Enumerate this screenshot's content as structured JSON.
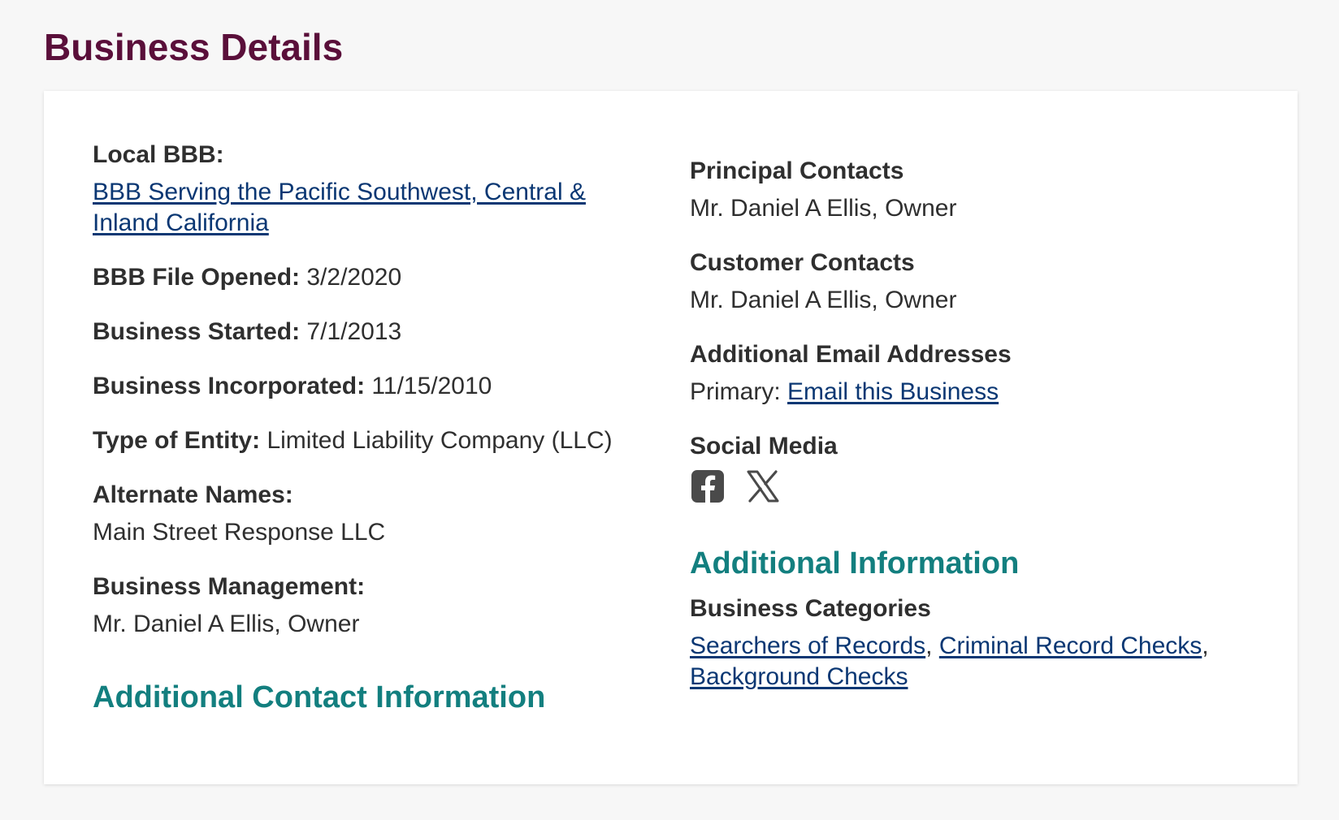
{
  "page": {
    "title": "Business Details"
  },
  "left": {
    "local_bbb": {
      "label": "Local BBB:",
      "link_line1": "BBB Serving the Pacific Southwest, Central &",
      "link_line2": "Inland California"
    },
    "file_opened": {
      "label": "BBB File Opened:",
      "value": "3/2/2020"
    },
    "business_started": {
      "label": "Business Started:",
      "value": "7/1/2013"
    },
    "business_incorporated": {
      "label": "Business Incorporated:",
      "value": "11/15/2010"
    },
    "entity_type": {
      "label": "Type of Entity:",
      "value": "Limited Liability Company (LLC)"
    },
    "alternate_names": {
      "label": "Alternate Names:",
      "value": "Main Street Response LLC"
    },
    "business_management": {
      "label": "Business Management:",
      "value": "Mr. Daniel A Ellis, Owner"
    },
    "additional_contact_heading": "Additional Contact Information"
  },
  "right": {
    "principal_contacts": {
      "label": "Principal Contacts",
      "value": "Mr. Daniel A Ellis, Owner"
    },
    "customer_contacts": {
      "label": "Customer Contacts",
      "value": "Mr. Daniel A Ellis, Owner"
    },
    "additional_email": {
      "label": "Additional Email Addresses",
      "prefix": "Primary:",
      "link": "Email this Business"
    },
    "social_media": {
      "label": "Social Media",
      "icons": [
        "facebook-icon",
        "x-twitter-icon"
      ]
    },
    "additional_info_heading": "Additional Information",
    "business_categories": {
      "label": "Business Categories",
      "items": [
        "Searchers of Records",
        "Criminal Record Checks",
        "Background Checks"
      ],
      "separator": ","
    }
  },
  "colors": {
    "title": "#5a0f3a",
    "section_heading": "#137f7f",
    "link": "#0a3773",
    "text": "#2f2f2f",
    "icon": "#4a4a4a",
    "background": "#f7f7f7",
    "card": "#ffffff"
  }
}
